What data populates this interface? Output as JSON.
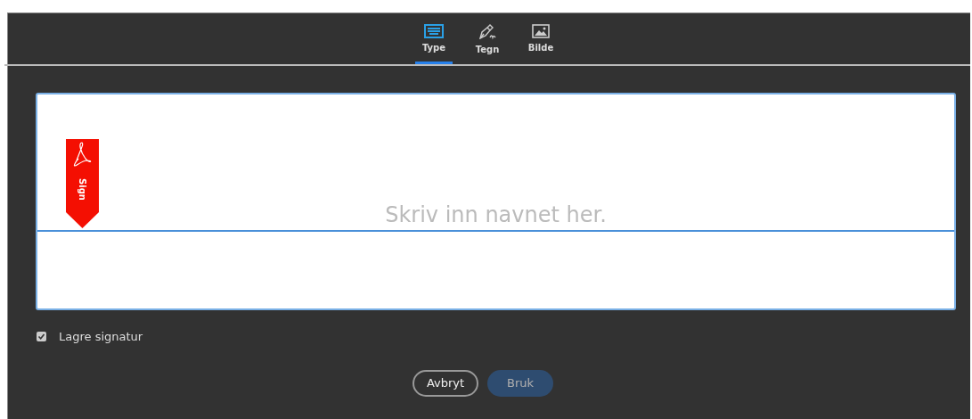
{
  "tabs": [
    {
      "label": "Type",
      "kind": "keyboard",
      "selected": true
    },
    {
      "label": "Tegn",
      "kind": "pen",
      "selected": false
    },
    {
      "label": "Bilde",
      "kind": "image",
      "selected": false
    }
  ],
  "signature_field": {
    "placeholder": "Skriv inn navnet her.",
    "flag_label": "Sign"
  },
  "save_signature": {
    "label": "Lagre signatur",
    "checked": true
  },
  "buttons": [
    {
      "label": "Avbryt",
      "kind": "secondary",
      "disabled": false
    },
    {
      "label": "Bruk",
      "kind": "primary",
      "disabled": true
    }
  ]
}
